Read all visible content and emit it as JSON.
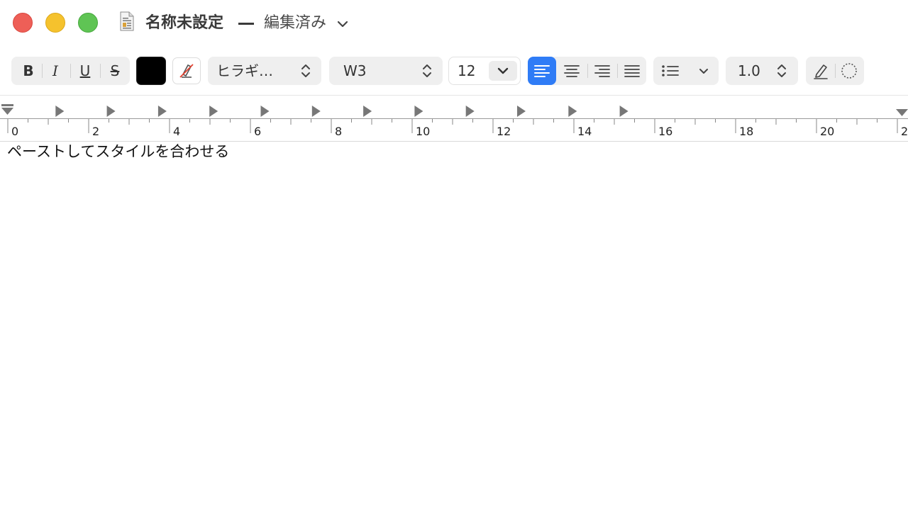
{
  "window": {
    "title": "名称未設定",
    "status": "編集済み"
  },
  "toolbar": {
    "bold_label": "B",
    "italic_label": "I",
    "underline_label": "U",
    "strike_label": "S",
    "text_color": "#000000",
    "font_family": "ヒラギ…",
    "font_weight": "W3",
    "font_size": "12",
    "alignment_selected": "left",
    "line_spacing": "1.0",
    "accent_color": "#2f7cf6"
  },
  "ruler": {
    "labels": [
      "0",
      "2",
      "4",
      "6",
      "8",
      "10",
      "12",
      "14",
      "16",
      "18",
      "20",
      "2"
    ]
  },
  "document": {
    "text": "ペーストしてスタイルを合わせる"
  }
}
